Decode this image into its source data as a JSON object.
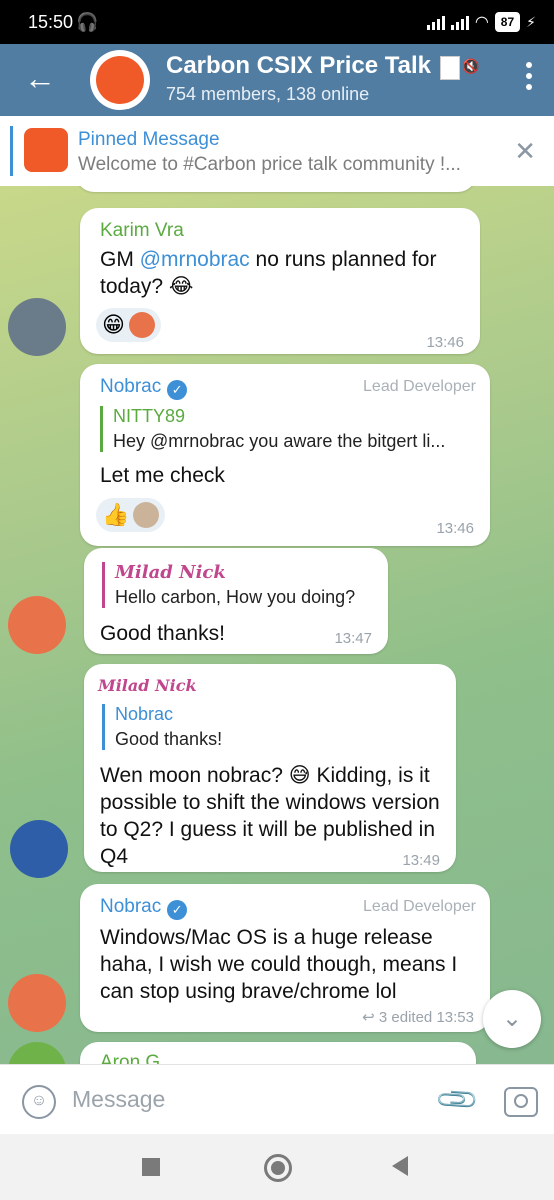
{
  "status": {
    "time": "15:50",
    "battery": "87"
  },
  "header": {
    "title": "Carbon CSIX Price Talk",
    "subtitle": "754 members, 138 online"
  },
  "pinned": {
    "title": "Pinned Message",
    "text": "Welcome to #Carbon price talk community !..."
  },
  "messages": [
    {
      "name": "Karim Vra",
      "text_prefix": "GM ",
      "mention": "@mrnobrac",
      "text_suffix": " no runs planned for today? 😂",
      "reactions": [
        "😁"
      ],
      "time": "13:46"
    },
    {
      "name": "Nobrac",
      "role": "Lead Developer",
      "reply_name": "NITTY89",
      "reply_text": "Hey @mrnobrac you aware the bitgert li...",
      "text": "Let me check",
      "reactions": [
        "👍"
      ],
      "time": "13:46"
    },
    {
      "name": "Milad Nick",
      "reply_text": "Hello carbon, How you doing?",
      "text": "Good thanks!",
      "time": "13:47"
    },
    {
      "name": "Milad Nick",
      "reply_name": "Nobrac",
      "reply_text": "Good thanks!",
      "text": "Wen moon nobrac? 😅 Kidding, is it possible to shift the windows version to Q2? I guess it will be published in Q4",
      "time": "13:49"
    },
    {
      "name": "Nobrac",
      "role": "Lead Developer",
      "text": "Windows/Mac OS is a huge release haha, I wish we could though, means I can stop using brave/chrome lol",
      "replies": "3",
      "edited": "edited",
      "time": "13:53"
    },
    {
      "name": "Aron G"
    }
  ],
  "composer": {
    "placeholder": "Message"
  },
  "colors": {
    "header": "#517da2",
    "accent": "#3d8fd6",
    "green_name": "#5aab3f"
  }
}
